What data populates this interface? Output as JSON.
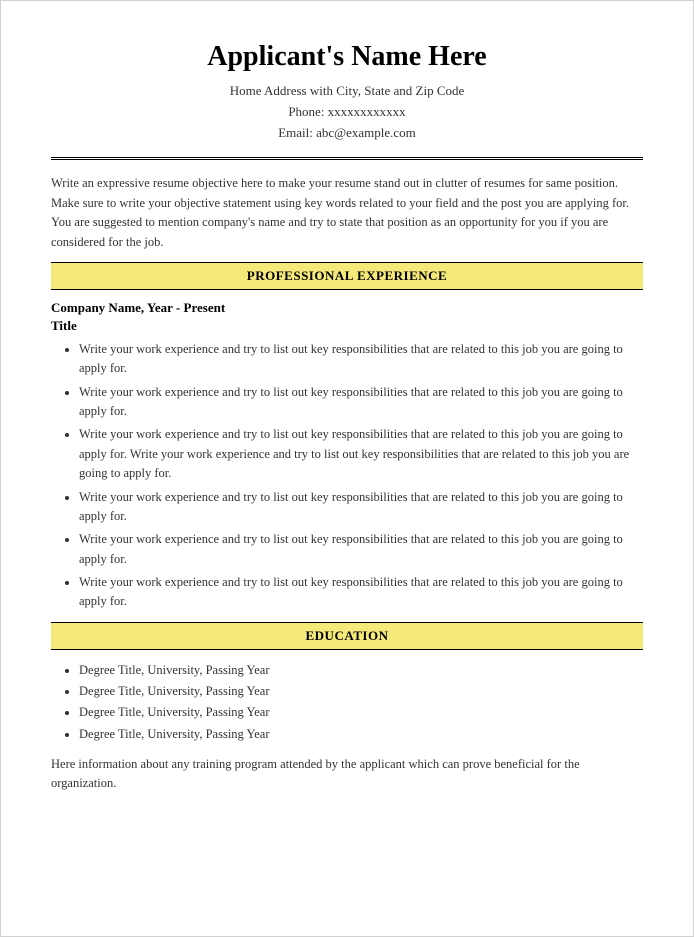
{
  "header": {
    "name": "Applicant's Name Here",
    "address": "Home Address with City, State and Zip Code",
    "phone": "Phone: xxxxxxxxxxxx",
    "email": "Email: abc@example.com"
  },
  "objective": {
    "text": "Write an expressive resume objective here to make your resume stand out in clutter of resumes for same position. Make sure to write your objective statement using key words related to your field and the post you are applying for. You are suggested to mention company's name and try to state that position as an opportunity for you if you are considered for the job."
  },
  "professional_experience": {
    "section_title": "PROFESSIONAL EXPERIENCE",
    "company": "Company Name, Year - Present",
    "title": "Title",
    "items": [
      "Write your work experience and try to list out key responsibilities that are related to this job you are going to apply for.",
      "Write your work experience and try to list out key responsibilities that are related to this job you are going to apply for.",
      "Write your work experience and try to list out key responsibilities that are related to this job you are going to apply for. Write your work experience and try to list out key responsibilities that are related to this job you are going to apply for.",
      "Write your work experience and try to list out key responsibilities that are related to this job you are going to apply for.",
      "Write your work experience and try to list out key responsibilities that are related to this job you are going to apply for.",
      "Write your work experience and try to list out key responsibilities that are related to this job you are going to apply for."
    ]
  },
  "education": {
    "section_title": "EDUCATION",
    "items": [
      "Degree Title, University, Passing Year",
      "Degree Title, University, Passing Year",
      "Degree Title, University, Passing Year",
      "Degree Title, University, Passing Year"
    ],
    "training_text": "Here information about any training program attended by the applicant which can prove beneficial for the organization."
  }
}
